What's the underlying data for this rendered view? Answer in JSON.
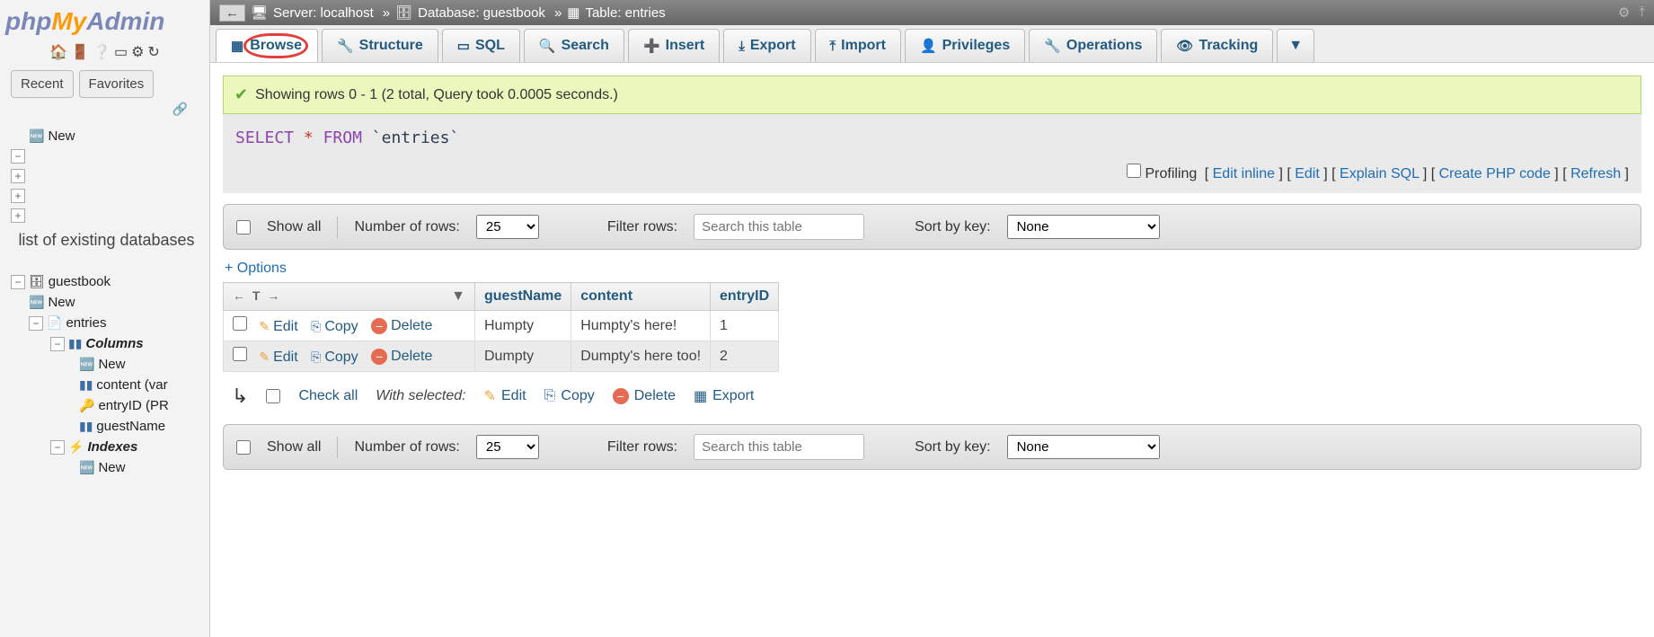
{
  "logo": {
    "php": "php",
    "my": "My",
    "admin": "Admin"
  },
  "sidebar": {
    "tabs": {
      "recent": "Recent",
      "favorites": "Favorites"
    },
    "overlay_text": "list of existing databases",
    "nodes": {
      "new_top": "New",
      "guestbook": "guestbook",
      "gb_new": "New",
      "entries": "entries",
      "columns": "Columns",
      "col_new": "New",
      "col_content": "content (var",
      "col_entryid": "entryID (PR",
      "col_guestname": "guestName",
      "indexes": "Indexes",
      "idx_new": "New"
    }
  },
  "breadcrumb": {
    "server_label": "Server: localhost",
    "db_label": "Database: guestbook",
    "table_label": "Table: entries"
  },
  "tabs": {
    "browse": "Browse",
    "structure": "Structure",
    "sql": "SQL",
    "search": "Search",
    "insert": "Insert",
    "export": "Export",
    "import": "Import",
    "privileges": "Privileges",
    "operations": "Operations",
    "tracking": "Tracking"
  },
  "status_msg": "Showing rows 0 - 1 (2 total, Query took 0.0005 seconds.)",
  "query": {
    "select": "SELECT",
    "star": "*",
    "from": "FROM",
    "ident": "`entries`"
  },
  "sql_actions": {
    "profiling": "Profiling",
    "edit_inline": "Edit inline",
    "edit": "Edit",
    "explain": "Explain SQL",
    "create_php": "Create PHP code",
    "refresh": "Refresh"
  },
  "toolbar": {
    "show_all": "Show all",
    "num_rows_label": "Number of rows:",
    "num_rows_value": "25",
    "filter_label": "Filter rows:",
    "filter_placeholder": "Search this table",
    "sort_label": "Sort by key:",
    "sort_value": "None"
  },
  "options_link": "+ Options",
  "columns": {
    "guestName": "guestName",
    "content": "content",
    "entryID": "entryID"
  },
  "row_actions": {
    "edit": "Edit",
    "copy": "Copy",
    "delete": "Delete"
  },
  "rows": [
    {
      "guestName": "Humpty",
      "content": "Humpty's here!",
      "entryID": "1"
    },
    {
      "guestName": "Dumpty",
      "content": "Dumpty's here too!",
      "entryID": "2"
    }
  ],
  "bulk": {
    "check_all": "Check all",
    "with_selected": "With selected:",
    "edit": "Edit",
    "copy": "Copy",
    "delete": "Delete",
    "export": "Export"
  }
}
